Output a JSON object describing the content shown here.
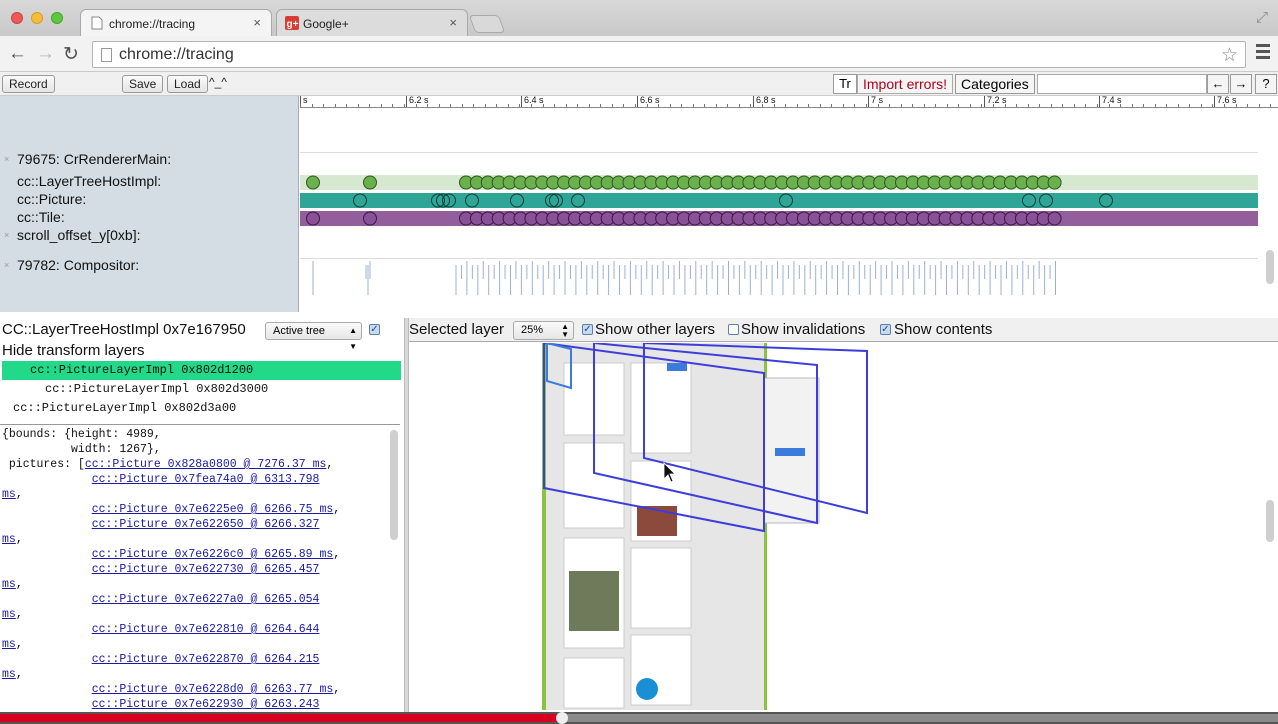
{
  "browser": {
    "tabs": [
      {
        "title": "chrome://tracing",
        "active": true,
        "close": "×"
      },
      {
        "title": "Google+",
        "active": false,
        "close": "×"
      }
    ],
    "url": "chrome://tracing",
    "nav": {
      "back": "←",
      "forward": "→",
      "reload": "↻"
    },
    "star": "☆",
    "fullscreen_icon": "⤢"
  },
  "controls": {
    "record": "Record",
    "save": "Save",
    "load": "Load",
    "caret": "^_^",
    "tr": "Tr",
    "import_errors": "Import errors!",
    "categories": "Categories",
    "search_value": "",
    "prev": "←",
    "next": "→",
    "help": "?"
  },
  "timeline": {
    "ruler": [
      "s",
      "6.2 s",
      "6.4 s",
      "6.6 s",
      "6.8 s",
      "7 s",
      "7.2 s",
      "7.4 s",
      "7.6 s"
    ],
    "rows": [
      {
        "label": "79675: CrRendererMain:",
        "collapsible": true
      },
      {
        "label": "cc::LayerTreeHostImpl:",
        "collapsible": false
      },
      {
        "label": "cc::Picture:",
        "collapsible": false
      },
      {
        "label": "cc::Tile:",
        "collapsible": false
      },
      {
        "label": "scroll_offset_y[0xb]:",
        "collapsible": true
      },
      {
        "label": "79782: Compositor:",
        "collapsible": true
      }
    ],
    "collapse_glyph": "×",
    "colors": {
      "lthi_bg": "#d6e8cf",
      "lthi_dot": "#6ab04c",
      "picture_bg": "#2fa597",
      "tile_bg": "#925e9c",
      "tile_dot": "#8a5098",
      "compositor": "#9bb0d2"
    }
  },
  "analysis": {
    "header": "CC::LayerTreeHostImpl 0x7e167950",
    "tree_select": "Active tree",
    "hide_transform": "Hide transform layers",
    "layers": [
      {
        "label": "cc::PictureLayerImpl 0x802d1200",
        "selected": true
      },
      {
        "label": "cc::PictureLayerImpl 0x802d3000",
        "selected": false
      },
      {
        "label": "cc::PictureLayerImpl 0x802d3a00",
        "selected": false
      }
    ],
    "json_lines": [
      {
        "prefix": "{bounds: {height: 4989,",
        "link": "",
        "suffix": ""
      },
      {
        "prefix": "          width: 1267},",
        "link": "",
        "suffix": ""
      },
      {
        "prefix": " pictures: [",
        "link": "cc::Picture 0x828a0800 @ 7276.37 ms",
        "suffix": ","
      },
      {
        "prefix": "             ",
        "link": "cc::Picture 0x7fea74a0 @ 6313.798",
        "suffix": ""
      },
      {
        "prefix": "",
        "link": "ms",
        "suffix": ","
      },
      {
        "prefix": "             ",
        "link": "cc::Picture 0x7e6225e0 @ 6266.75 ms",
        "suffix": ","
      },
      {
        "prefix": "             ",
        "link": "cc::Picture 0x7e622650 @ 6266.327",
        "suffix": ""
      },
      {
        "prefix": "",
        "link": "ms",
        "suffix": ","
      },
      {
        "prefix": "             ",
        "link": "cc::Picture 0x7e6226c0 @ 6265.89 ms",
        "suffix": ","
      },
      {
        "prefix": "             ",
        "link": "cc::Picture 0x7e622730 @ 6265.457",
        "suffix": ""
      },
      {
        "prefix": "",
        "link": "ms",
        "suffix": ","
      },
      {
        "prefix": "             ",
        "link": "cc::Picture 0x7e6227a0 @ 6265.054",
        "suffix": ""
      },
      {
        "prefix": "",
        "link": "ms",
        "suffix": ","
      },
      {
        "prefix": "             ",
        "link": "cc::Picture 0x7e622810 @ 6264.644",
        "suffix": ""
      },
      {
        "prefix": "",
        "link": "ms",
        "suffix": ","
      },
      {
        "prefix": "             ",
        "link": "cc::Picture 0x7e622870 @ 6264.215",
        "suffix": ""
      },
      {
        "prefix": "",
        "link": "ms",
        "suffix": ","
      },
      {
        "prefix": "             ",
        "link": "cc::Picture 0x7e6228d0 @ 6263.77 ms",
        "suffix": ","
      },
      {
        "prefix": "             ",
        "link": "cc::Picture 0x7e622930 @ 6263.243",
        "suffix": ""
      }
    ]
  },
  "layer_view": {
    "selected_layer_label": "Selected layer",
    "zoom": "25%",
    "show_other_layers": "Show other layers",
    "show_invalidations": "Show invalidations",
    "show_contents": "Show contents",
    "show_other_layers_checked": true,
    "show_invalidations_checked": false,
    "show_contents_checked": true
  },
  "video": {
    "progress": 0.44,
    "buffered": 1.0
  }
}
